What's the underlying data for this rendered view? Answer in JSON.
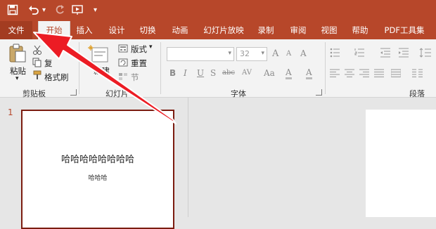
{
  "quick_access": {
    "icons": [
      "save-icon",
      "undo-icon",
      "redo-icon",
      "present-icon",
      "customize-icon"
    ],
    "undo_dropdown": "▾",
    "customize_glyph": "▾"
  },
  "tabs": {
    "file": "文件",
    "home": "开始",
    "insert": "插入",
    "design": "设计",
    "transitions": "切换",
    "animations": "动画",
    "slideshow": "幻灯片放映",
    "record": "录制",
    "review": "审阅",
    "view": "视图",
    "help": "帮助",
    "pdf": "PDF工具集"
  },
  "ribbon": {
    "clipboard": {
      "paste": "粘贴",
      "copy": "复",
      "format_painter": "格式刷",
      "group_label": "剪贴板",
      "dropdown": "▾"
    },
    "slides": {
      "new_slide": "新建",
      "layout": "版式",
      "reset": "重置",
      "section": "节",
      "group_label": "幻灯片"
    },
    "font": {
      "font_name": "",
      "font_size": "32",
      "grow": "A",
      "shrink": "A",
      "clear": "A",
      "bold": "B",
      "italic": "I",
      "underline": "U",
      "shadow": "S",
      "strike": "abc",
      "spacing": "AV",
      "case": "Aa",
      "highlight": "A",
      "color": "A",
      "group_label": "字体"
    },
    "paragraph": {
      "group_label": "段落"
    }
  },
  "slides_pane": {
    "slide_number": "1",
    "title": "哈哈哈哈哈哈哈哈",
    "subtitle": "哈哈哈"
  },
  "colors": {
    "accent": "#b7472a",
    "file_tab": "#a33c21",
    "thumb_border": "#7b1c10",
    "arrow": "#ec1c24"
  }
}
